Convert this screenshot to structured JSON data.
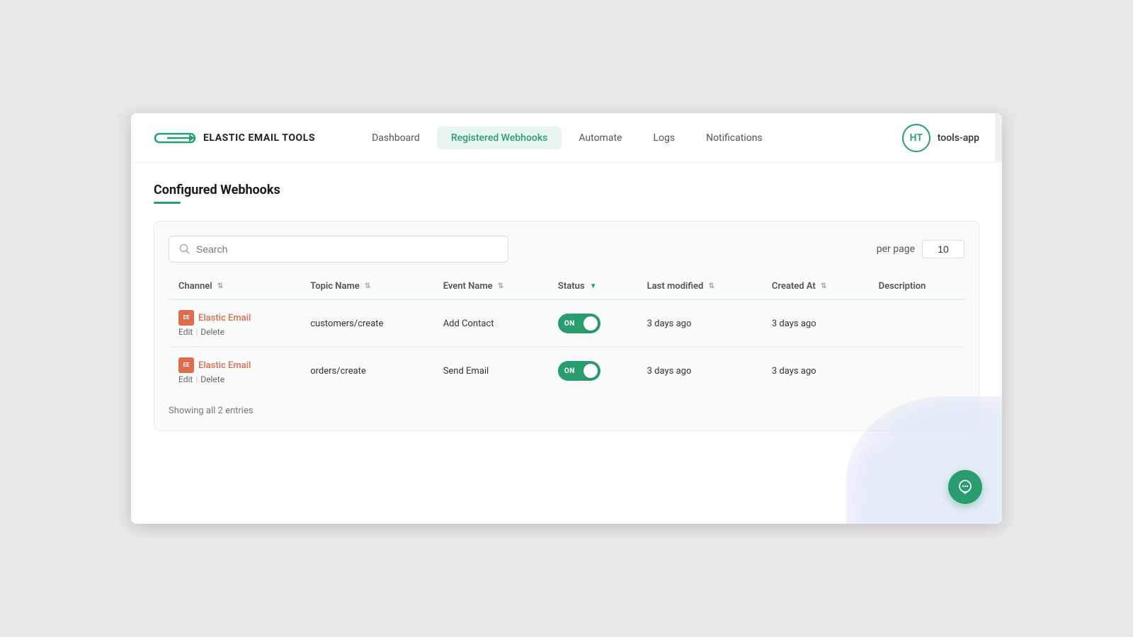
{
  "app": {
    "brand_name": "ELASTIC EMAIL TOOLS",
    "app_label": "tools-app",
    "user_initials": "HT"
  },
  "nav": {
    "links": [
      {
        "id": "dashboard",
        "label": "Dashboard",
        "active": false
      },
      {
        "id": "registered-webhooks",
        "label": "Registered Webhooks",
        "active": true
      },
      {
        "id": "automate",
        "label": "Automate",
        "active": false
      },
      {
        "id": "logs",
        "label": "Logs",
        "active": false
      },
      {
        "id": "notifications",
        "label": "Notifications",
        "active": false
      }
    ]
  },
  "page": {
    "title": "Configured Webhooks"
  },
  "toolbar": {
    "search_placeholder": "Search",
    "per_page_label": "per page",
    "per_page_value": "10"
  },
  "table": {
    "columns": [
      {
        "id": "channel",
        "label": "Channel"
      },
      {
        "id": "topic_name",
        "label": "Topic Name"
      },
      {
        "id": "event_name",
        "label": "Event Name"
      },
      {
        "id": "status",
        "label": "Status"
      },
      {
        "id": "last_modified",
        "label": "Last modified"
      },
      {
        "id": "created_at",
        "label": "Created At"
      },
      {
        "id": "description",
        "label": "Description"
      }
    ],
    "rows": [
      {
        "channel_name": "Elastic Email",
        "topic_name": "customers/create",
        "event_name": "Add Contact",
        "status": "ON",
        "last_modified": "3 days ago",
        "created_at": "3 days ago",
        "description": ""
      },
      {
        "channel_name": "Elastic Email",
        "topic_name": "orders/create",
        "event_name": "Send Email",
        "status": "ON",
        "last_modified": "3 days ago",
        "created_at": "3 days ago",
        "description": ""
      }
    ],
    "edit_label": "Edit",
    "delete_label": "Delete",
    "showing_label": "Showing all 2 entries"
  }
}
